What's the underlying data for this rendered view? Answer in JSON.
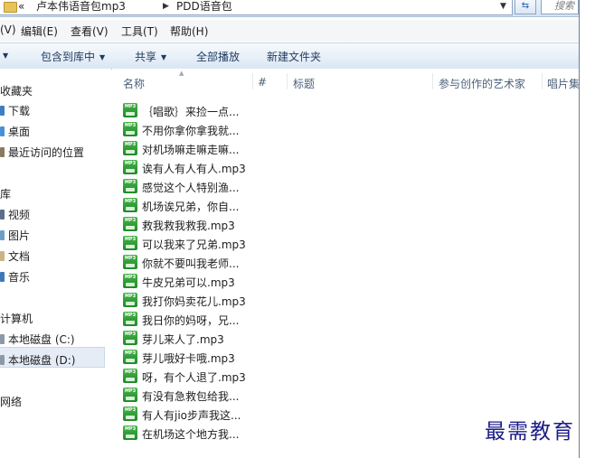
{
  "address_bar": {
    "overflow": "«",
    "crumbs": [
      "卢本伟语音包mp3",
      "PDD语音包"
    ],
    "search_placeholder": "搜索"
  },
  "menu": [
    "(V)",
    "编辑(E)",
    "查看(V)",
    "工具(T)",
    "帮助(H)"
  ],
  "toolbar": [
    "包含到库中",
    "共享",
    "全部播放",
    "新建文件夹"
  ],
  "nav": {
    "favorites": "收藏夹",
    "fav_items": [
      "下载",
      "桌面",
      "最近访问的位置"
    ],
    "libraries": "库",
    "lib_items": [
      "视频",
      "图片",
      "文档",
      "音乐"
    ],
    "computer": "计算机",
    "drives": [
      "本地磁盘 (C:)",
      "本地磁盘 (D:)"
    ],
    "network": "网络"
  },
  "columns": [
    "名称",
    "#",
    "标题",
    "参与创作的艺术家",
    "唱片集"
  ],
  "icon_label": "MP3",
  "files": [
    "｛唱歌｝来捡一点...",
    "不用你拿你拿我就...",
    "对机场嘛走嘛走嘛...",
    "诶有人有人有人.mp3",
    "感觉这个人特别渔...",
    "机场诶兄弟，你自...",
    "救我救我救我.mp3",
    "可以我来了兄弟.mp3",
    "你就不要叫我老师...",
    "牛皮兄弟可以.mp3",
    "我打你妈卖花儿.mp3",
    "我日你的妈呀，兄...",
    "芽儿来人了.mp3",
    "芽儿哦好卡哦.mp3",
    "呀，有个人退了.mp3",
    "有没有急救包给我...",
    "有人有jio步声我这...",
    "在机场这个地方我..."
  ],
  "watermark": "最需教育"
}
